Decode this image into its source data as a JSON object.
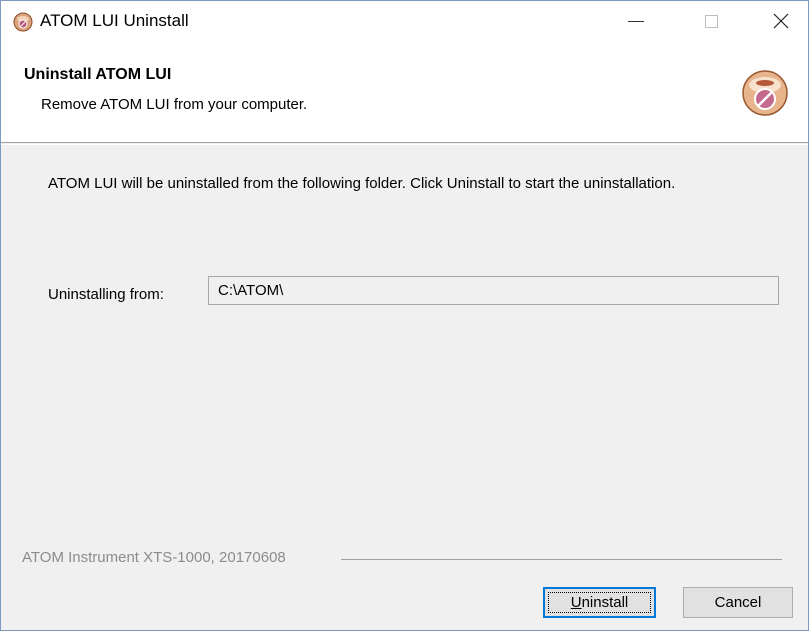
{
  "window": {
    "title": "ATOM LUI Uninstall",
    "accent_color": "#0078d7",
    "border_color": "#7a98c0",
    "background": "#f0f0f0",
    "controls": {
      "minimize_icon": "minimize-icon",
      "maximize_icon": "maximize-icon",
      "close_icon": "close-icon"
    },
    "app_icon": "uninstaller-icon"
  },
  "header": {
    "title": "Uninstall ATOM LUI",
    "subtitle": "Remove ATOM LUI from your computer.",
    "icon": "uninstall-disc-icon"
  },
  "body": {
    "description": "ATOM LUI will be uninstalled from the following folder. Click Uninstall to start the uninstallation.",
    "uninstall_from": {
      "label": "Uninstalling from:",
      "value": "C:\\ATOM\\"
    }
  },
  "branding": {
    "text": "ATOM Instrument XTS-1000, 20170608"
  },
  "buttons": {
    "uninstall": {
      "accel": "U",
      "rest": "ninstall"
    },
    "cancel": "Cancel"
  }
}
